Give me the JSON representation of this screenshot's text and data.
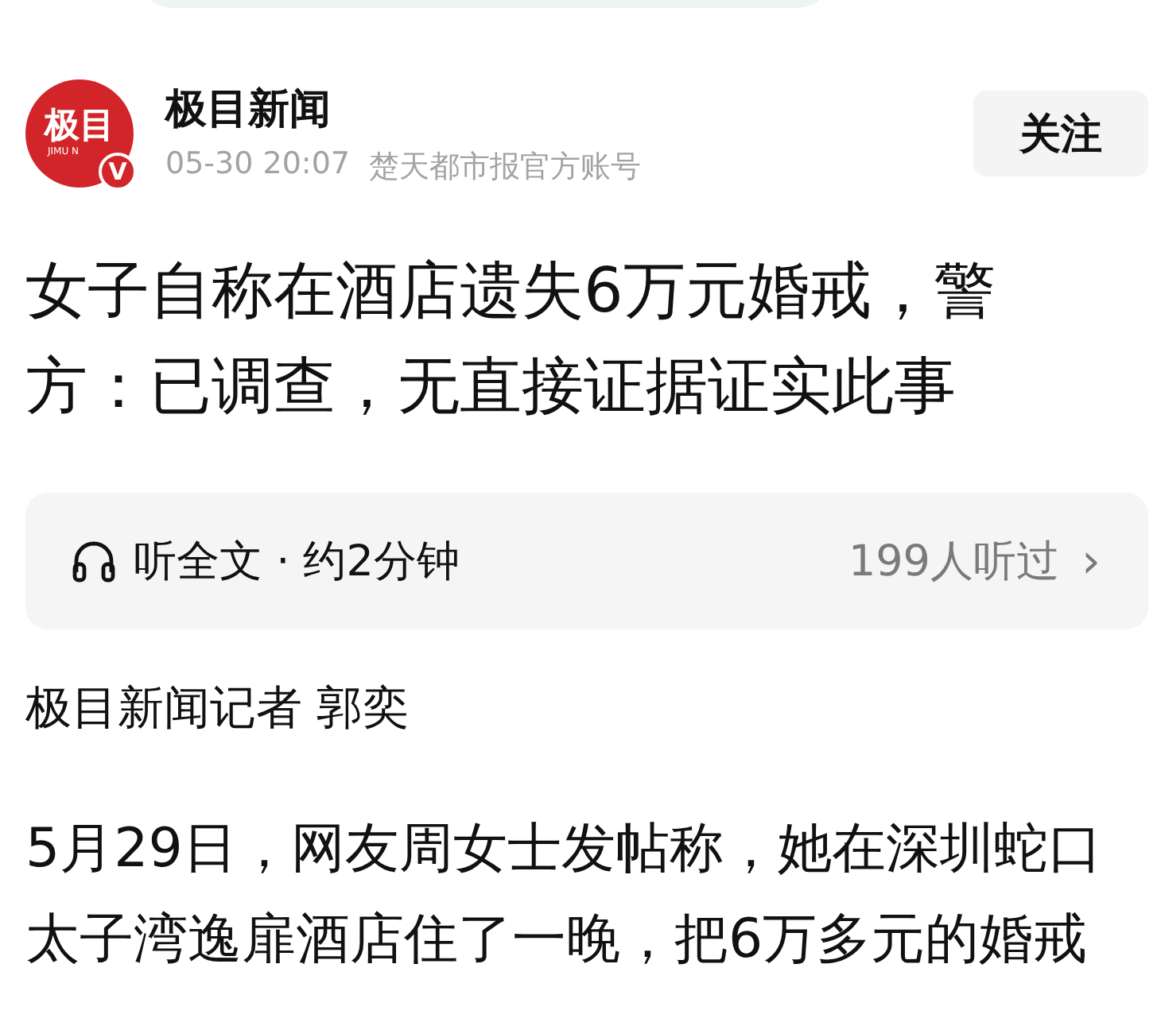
{
  "author": {
    "logo_text": "极目",
    "logo_subtext": "JIMU N",
    "badge": "V",
    "name": "极目新闻",
    "time": "05-30 20:07",
    "source": "楚天都市报官方账号"
  },
  "follow_button": {
    "label": "关注"
  },
  "title": "女子自称在酒店遗失6万元婚戒，警方：已调查，无直接证据证实此事",
  "audio": {
    "label": "听全文 · 约2分钟",
    "listeners": "199人听过",
    "arrow": "›"
  },
  "byline": "极目新闻记者 郭奕",
  "paragraph": [
    {
      "kind": "text",
      "text": "5月29日，网友周女士发帖称，她在深圳蛇口太子湾逸扉酒店住了一晚，把6万多元的婚戒"
    }
  ]
}
